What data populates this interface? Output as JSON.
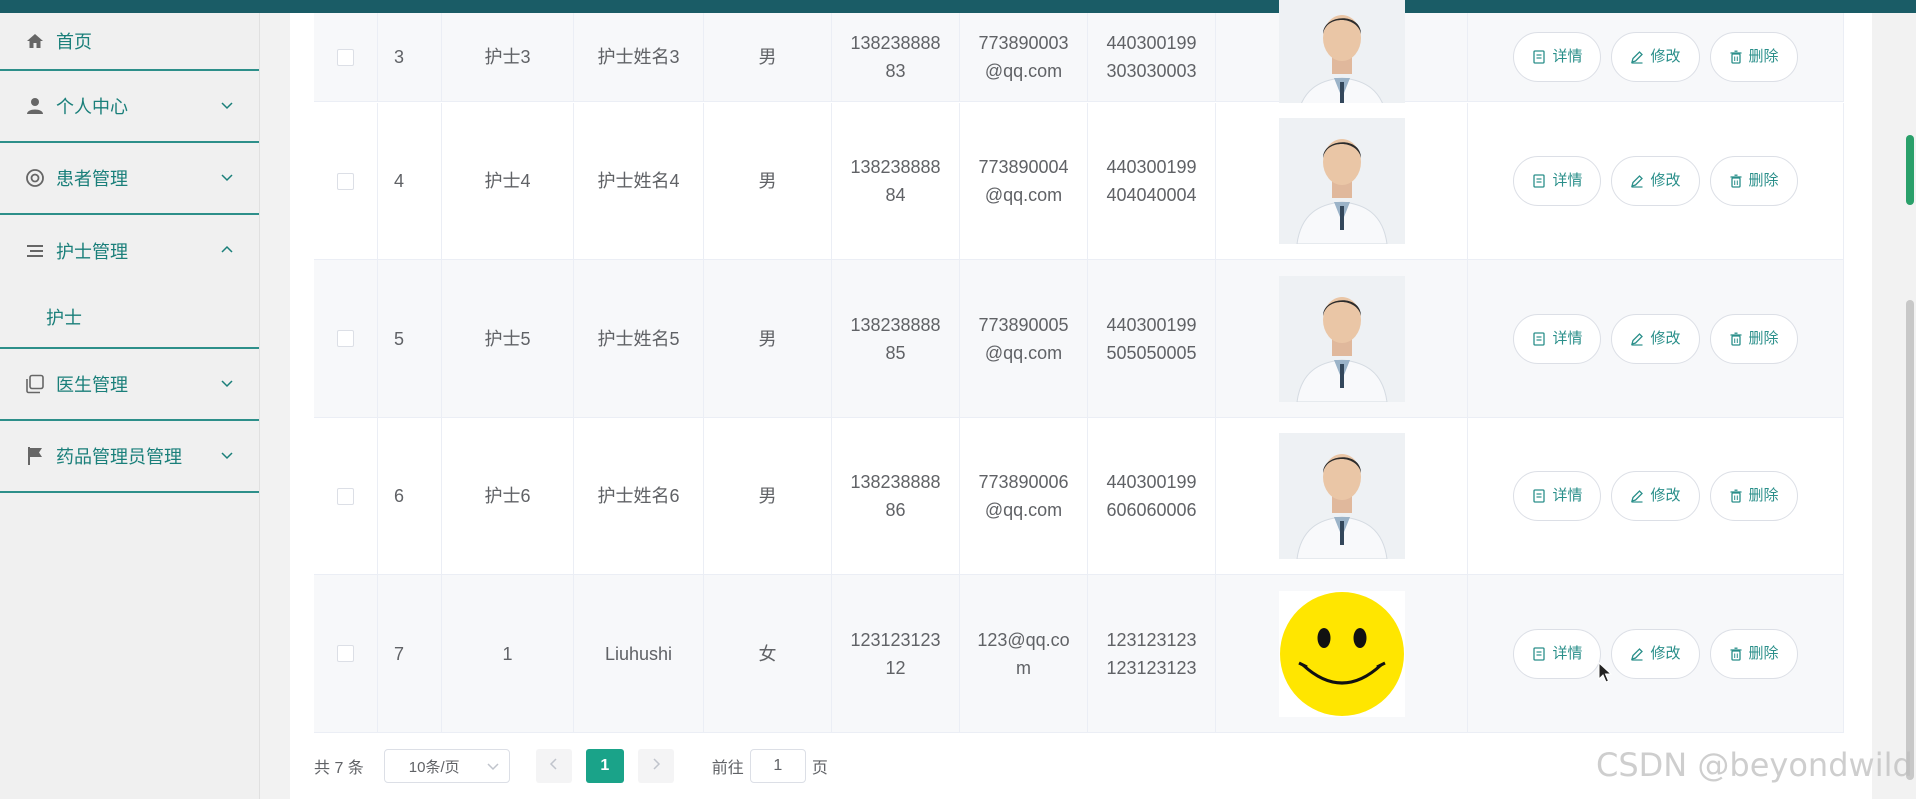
{
  "sidebar": {
    "items": [
      {
        "label": "首页",
        "icon": "home-icon"
      },
      {
        "label": "个人中心",
        "icon": "user-icon"
      },
      {
        "label": "患者管理",
        "icon": "lifebuoy-icon"
      },
      {
        "label": "护士管理",
        "icon": "list-icon"
      },
      {
        "label": "医生管理",
        "icon": "copy-icon"
      },
      {
        "label": "药品管理员管理",
        "icon": "flag-icon"
      }
    ],
    "sub_items": [
      {
        "label": "护士"
      }
    ]
  },
  "table": {
    "rows": [
      {
        "id": "3",
        "account": "护士3",
        "name": "护士姓名3",
        "gender": "男",
        "phone": "13823888883",
        "email": "773890003@qq.com",
        "idcard": "440300199303030003",
        "photo": "doctor-photo"
      },
      {
        "id": "4",
        "account": "护士4",
        "name": "护士姓名4",
        "gender": "男",
        "phone": "13823888884",
        "email": "773890004@qq.com",
        "idcard": "440300199404040004",
        "photo": "doctor-photo"
      },
      {
        "id": "5",
        "account": "护士5",
        "name": "护士姓名5",
        "gender": "男",
        "phone": "13823888885",
        "email": "773890005@qq.com",
        "idcard": "440300199505050005",
        "photo": "doctor-photo"
      },
      {
        "id": "6",
        "account": "护士6",
        "name": "护士姓名6",
        "gender": "男",
        "phone": "13823888886",
        "email": "773890006@qq.com",
        "idcard": "440300199606060006",
        "photo": "doctor-photo"
      },
      {
        "id": "7",
        "account": "1",
        "name": "Liuhushi",
        "gender": "女",
        "phone": "12312312312",
        "email": "123@qq.com",
        "idcard": "123123123123123123",
        "photo": "smiley-face"
      }
    ],
    "actions": {
      "detail": "详情",
      "edit": "修改",
      "delete": "删除"
    }
  },
  "pagination": {
    "total": "共 7 条",
    "page_size": "10条/页",
    "current_page": "1",
    "goto_prefix": "前往",
    "goto_value": "1",
    "goto_suffix": "页"
  },
  "watermark": "CSDN @beyondwild",
  "colors": {
    "accent": "#1aa389",
    "menu_text": "#1a7f7a",
    "topbar": "#1a5c66"
  }
}
